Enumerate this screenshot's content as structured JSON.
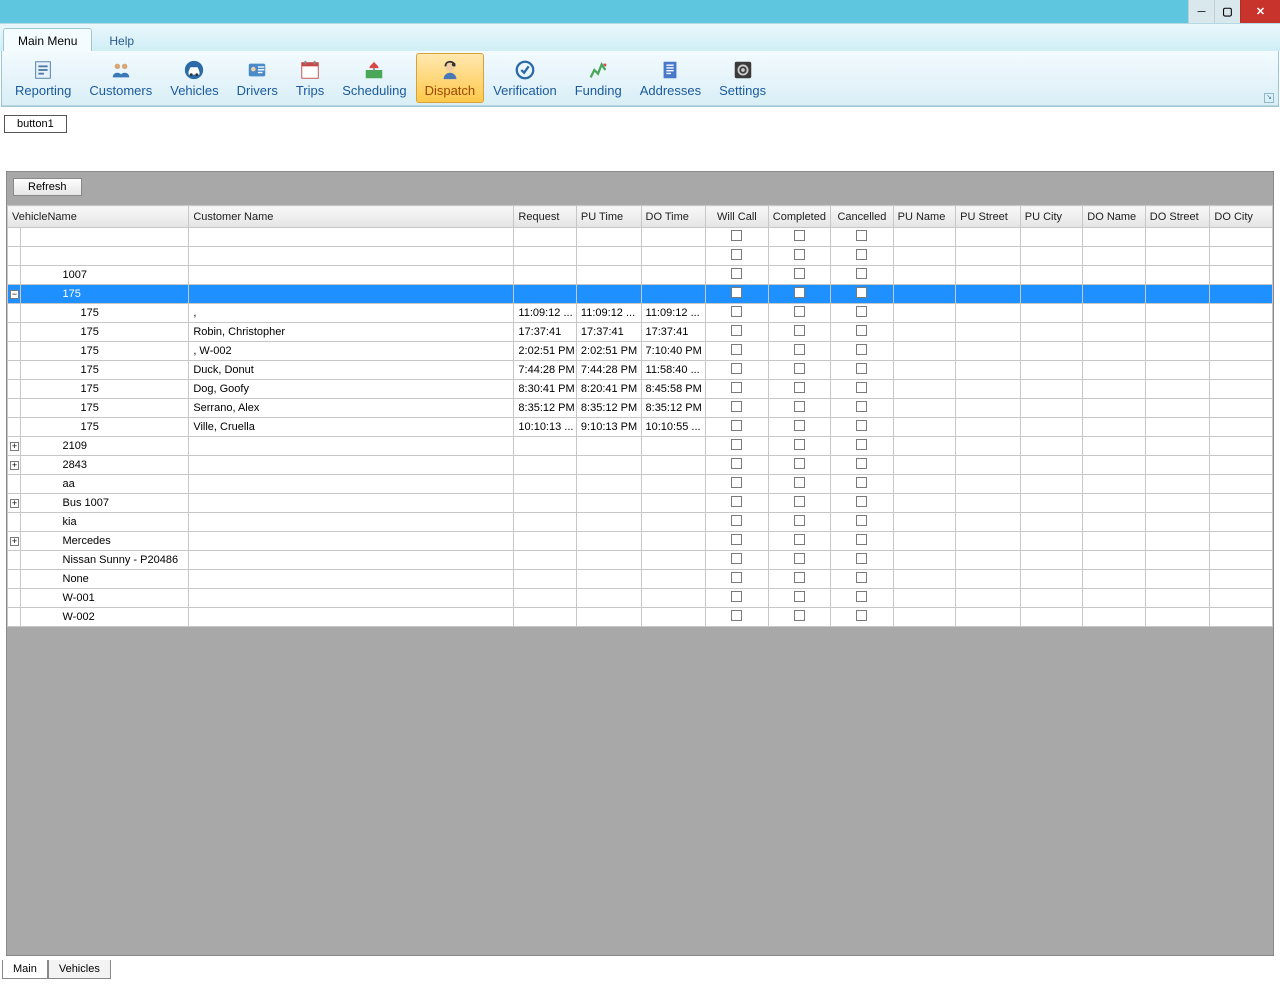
{
  "window": {
    "minimize": "—",
    "maximize": "❐",
    "close": "✕"
  },
  "menuTabs": {
    "main": "Main Menu",
    "help": "Help"
  },
  "ribbon": {
    "items": [
      {
        "id": "reporting",
        "label": "Reporting"
      },
      {
        "id": "customers",
        "label": "Customers"
      },
      {
        "id": "vehicles",
        "label": "Vehicles"
      },
      {
        "id": "drivers",
        "label": "Drivers"
      },
      {
        "id": "trips",
        "label": "Trips"
      },
      {
        "id": "scheduling",
        "label": "Scheduling"
      },
      {
        "id": "dispatch",
        "label": "Dispatch",
        "active": true
      },
      {
        "id": "verification",
        "label": "Verification"
      },
      {
        "id": "funding",
        "label": "Funding"
      },
      {
        "id": "addresses",
        "label": "Addresses"
      },
      {
        "id": "settings",
        "label": "Settings"
      }
    ]
  },
  "button1": "button1",
  "refresh": "Refresh",
  "columns": {
    "vehicleName": "VehicleName",
    "customerName": "Customer Name",
    "request": "Request",
    "puTime": "PU Time",
    "doTime": "DO Time",
    "willCall": "Will Call",
    "completed": "Completed",
    "cancelled": "Cancelled",
    "puName": "PU Name",
    "puStreet": "PU Street",
    "puCity": "PU City",
    "doName": "DO Name",
    "doStreet": "DO Street",
    "doCity": "DO City"
  },
  "rows": [
    {
      "exp": "",
      "vn": "",
      "cn": "",
      "rt": "",
      "pt": "",
      "dt": ""
    },
    {
      "exp": "",
      "vn": "",
      "cn": "",
      "rt": "",
      "pt": "",
      "dt": ""
    },
    {
      "exp": "",
      "vn": "1007",
      "cn": "",
      "rt": "",
      "pt": "",
      "dt": ""
    },
    {
      "exp": "minus",
      "vn": "175",
      "cn": "",
      "rt": "",
      "pt": "",
      "dt": "",
      "selected": true
    },
    {
      "exp": "",
      "vn": "175",
      "child": true,
      "cn": ",",
      "rt": "11:09:12 ...",
      "pt": "11:09:12 ...",
      "dt": "11:09:12 ..."
    },
    {
      "exp": "",
      "vn": "175",
      "child": true,
      "cn": "Robin, Christopher",
      "rt": "17:37:41",
      "pt": "17:37:41",
      "dt": "17:37:41"
    },
    {
      "exp": "",
      "vn": "175",
      "child": true,
      "cn": ", W-002",
      "rt": "2:02:51 PM",
      "pt": "2:02:51 PM",
      "dt": "7:10:40 PM"
    },
    {
      "exp": "",
      "vn": "175",
      "child": true,
      "cn": "Duck, Donut",
      "rt": "7:44:28 PM",
      "pt": "7:44:28 PM",
      "dt": "11:58:40 ..."
    },
    {
      "exp": "",
      "vn": "175",
      "child": true,
      "cn": "Dog, Goofy",
      "rt": "8:30:41 PM",
      "pt": "8:20:41 PM",
      "dt": "8:45:58 PM"
    },
    {
      "exp": "",
      "vn": "175",
      "child": true,
      "cn": "Serrano, Alex",
      "rt": "8:35:12 PM",
      "pt": "8:35:12 PM",
      "dt": "8:35:12 PM"
    },
    {
      "exp": "",
      "vn": "175",
      "child": true,
      "cn": "Ville, Cruella",
      "rt": "10:10:13 ...",
      "pt": "9:10:13 PM",
      "dt": "10:10:55 ..."
    },
    {
      "exp": "plus",
      "vn": "2109",
      "cn": "",
      "rt": "",
      "pt": "",
      "dt": ""
    },
    {
      "exp": "plus",
      "vn": "2843",
      "cn": "",
      "rt": "",
      "pt": "",
      "dt": ""
    },
    {
      "exp": "",
      "vn": "aa",
      "cn": "",
      "rt": "",
      "pt": "",
      "dt": ""
    },
    {
      "exp": "plus",
      "vn": "Bus 1007",
      "cn": "",
      "rt": "",
      "pt": "",
      "dt": ""
    },
    {
      "exp": "",
      "vn": "kia",
      "cn": "",
      "rt": "",
      "pt": "",
      "dt": ""
    },
    {
      "exp": "plus",
      "vn": "Mercedes",
      "cn": "",
      "rt": "",
      "pt": "",
      "dt": ""
    },
    {
      "exp": "",
      "vn": "Nissan Sunny - P20486",
      "cn": "",
      "rt": "",
      "pt": "",
      "dt": ""
    },
    {
      "exp": "",
      "vn": "None",
      "cn": "",
      "rt": "",
      "pt": "",
      "dt": ""
    },
    {
      "exp": "",
      "vn": "W-001",
      "cn": "",
      "rt": "",
      "pt": "",
      "dt": ""
    },
    {
      "exp": "",
      "vn": "W-002",
      "cn": "",
      "rt": "",
      "pt": "",
      "dt": ""
    }
  ],
  "bottomTabs": {
    "main": "Main",
    "vehicles": "Vehicles"
  }
}
